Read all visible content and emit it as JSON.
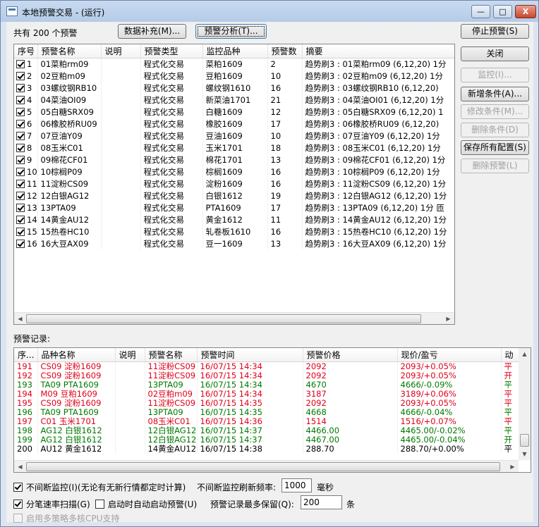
{
  "window": {
    "title": "本地预警交易 - (运行)",
    "min": "—",
    "max": "□",
    "close": "X"
  },
  "toolbar": {
    "count_label": "共有 200 个预警",
    "data_fill": "数据补充(M)...",
    "analysis": "预警分析(T)...",
    "stop": "停止预警(S)"
  },
  "side_buttons": {
    "close": "关闭",
    "monitor": "监控(I)...",
    "add_cond": "新增条件(A)...",
    "edit_cond": "修改条件(M)...",
    "del_cond": "删除条件(D)",
    "save_all": "保存所有配置(S)",
    "del_alert": "删除预警(L)"
  },
  "alerts": {
    "columns": [
      "序号",
      "预警名称",
      "说明",
      "预警类型",
      "监控品种",
      "预警数",
      "摘要"
    ],
    "rows": [
      {
        "no": "1",
        "name": "01菜粕rm09",
        "desc": "",
        "type": "程式化交易",
        "symbol": "菜粕1609",
        "count": "2",
        "summary": "趋势刷3 : 01菜粕rm09 (6,12,20) 1分",
        "checked": true
      },
      {
        "no": "2",
        "name": "02豆粕m09",
        "desc": "",
        "type": "程式化交易",
        "symbol": "豆粕1609",
        "count": "10",
        "summary": "趋势刷3 : 02豆粕m09 (6,12,20) 1分",
        "checked": true
      },
      {
        "no": "3",
        "name": "03螺纹钢RB10",
        "desc": "",
        "type": "程式化交易",
        "symbol": "螺纹钢1610",
        "count": "16",
        "summary": "趋势刷3 : 03螺纹钢RB10 (6,12,20)",
        "checked": true
      },
      {
        "no": "4",
        "name": "04菜油OI09",
        "desc": "",
        "type": "程式化交易",
        "symbol": "新菜油1701",
        "count": "21",
        "summary": "趋势刷3 : 04菜油OI01 (6,12,20) 1分",
        "checked": true
      },
      {
        "no": "5",
        "name": "05白糖SRX09",
        "desc": "",
        "type": "程式化交易",
        "symbol": "白糖1609",
        "count": "12",
        "summary": "趋势刷3 : 05白糖SRX09 (6,12,20) 1",
        "checked": true
      },
      {
        "no": "6",
        "name": "06橡胶桥RU09",
        "desc": "",
        "type": "程式化交易",
        "symbol": "橡胶1609",
        "count": "17",
        "summary": "趋势刷3 : 06橡胶桥RU09 (6,12,20)",
        "checked": true
      },
      {
        "no": "7",
        "name": "07豆油Y09",
        "desc": "",
        "type": "程式化交易",
        "symbol": "豆油1609",
        "count": "10",
        "summary": "趋势刷3 : 07豆油Y09 (6,12,20) 1分",
        "checked": true
      },
      {
        "no": "8",
        "name": "08玉米C01",
        "desc": "",
        "type": "程式化交易",
        "symbol": "玉米1701",
        "count": "18",
        "summary": "趋势刷3 : 08玉米C01 (6,12,20) 1分",
        "checked": true
      },
      {
        "no": "9",
        "name": "09棉花CF01",
        "desc": "",
        "type": "程式化交易",
        "symbol": "棉花1701",
        "count": "13",
        "summary": "趋势刷3 : 09棉花CF01 (6,12,20) 1分",
        "checked": true
      },
      {
        "no": "10",
        "name": "10棕榈P09",
        "desc": "",
        "type": "程式化交易",
        "symbol": "棕榈1609",
        "count": "16",
        "summary": "趋势刷3 : 10棕榈P09 (6,12,20) 1分",
        "checked": true
      },
      {
        "no": "11",
        "name": "11淀粉CS09",
        "desc": "",
        "type": "程式化交易",
        "symbol": "淀粉1609",
        "count": "16",
        "summary": "趋势刷3 : 11淀粉CS09 (6,12,20) 1分",
        "checked": true
      },
      {
        "no": "12",
        "name": "12白银AG12",
        "desc": "",
        "type": "程式化交易",
        "symbol": "白银1612",
        "count": "19",
        "summary": "趋势刷3 : 12白银AG12 (6,12,20) 1分",
        "checked": true
      },
      {
        "no": "13",
        "name": "13PTA09",
        "desc": "",
        "type": "程式化交易",
        "symbol": "PTA1609",
        "count": "17",
        "summary": "趋势刷3 : 13PTA09 (6,12,20) 1分 匝",
        "checked": true
      },
      {
        "no": "14",
        "name": "14黄金AU12",
        "desc": "",
        "type": "程式化交易",
        "symbol": "黄金1612",
        "count": "11",
        "summary": "趋势刷3 : 14黄金AU12 (6,12,20) 1分",
        "checked": true
      },
      {
        "no": "15",
        "name": "15热卷HC10",
        "desc": "",
        "type": "程式化交易",
        "symbol": "轧卷板1610",
        "count": "16",
        "summary": "趋势刷3 : 15热卷HC10 (6,12,20) 1分",
        "checked": true
      },
      {
        "no": "16",
        "name": "16大豆AX09",
        "desc": "",
        "type": "程式化交易",
        "symbol": "豆一1609",
        "count": "13",
        "summary": "趋势刷3 : 16大豆AX09 (6,12,20) 1分",
        "checked": true
      }
    ]
  },
  "records_label": "预警记录:",
  "records": {
    "columns": [
      "序...",
      "品种名称",
      "说明",
      "预警名称",
      "预警时间",
      "预警价格",
      "现价/盈亏",
      "动"
    ],
    "rows": [
      {
        "no": "191",
        "product": "CS09 淀粉1609",
        "desc": "",
        "alert": "11淀粉CS09",
        "time": "16/07/15 14:34",
        "price": "2092",
        "pnl": "2093/+0.05%",
        "act": "平",
        "color": "red"
      },
      {
        "no": "192",
        "product": "CS09 淀粉1609",
        "desc": "",
        "alert": "11淀粉CS09",
        "time": "16/07/15 14:34",
        "price": "2092",
        "pnl": "2093/+0.05%",
        "act": "开",
        "color": "red"
      },
      {
        "no": "193",
        "product": "TA09 PTA1609",
        "desc": "",
        "alert": "13PTA09",
        "time": "16/07/15 14:34",
        "price": "4670",
        "pnl": "4666/-0.09%",
        "act": "平",
        "color": "green"
      },
      {
        "no": "194",
        "product": "M09 豆粕1609",
        "desc": "",
        "alert": "02豆粕m09",
        "time": "16/07/15 14:34",
        "price": "3187",
        "pnl": "3189/+0.06%",
        "act": "平",
        "color": "red"
      },
      {
        "no": "195",
        "product": "CS09 淀粉1609",
        "desc": "",
        "alert": "11淀粉CS09",
        "time": "16/07/15 14:35",
        "price": "2092",
        "pnl": "2093/+0.05%",
        "act": "平",
        "color": "red"
      },
      {
        "no": "196",
        "product": "TA09 PTA1609",
        "desc": "",
        "alert": "13PTA09",
        "time": "16/07/15 14:35",
        "price": "4668",
        "pnl": "4666/-0.04%",
        "act": "平",
        "color": "green"
      },
      {
        "no": "197",
        "product": "C01 玉米1701",
        "desc": "",
        "alert": "08玉米C01",
        "time": "16/07/15 14:36",
        "price": "1514",
        "pnl": "1516/+0.07%",
        "act": "平",
        "color": "red"
      },
      {
        "no": "198",
        "product": "AG12 白银1612",
        "desc": "",
        "alert": "12白银AG12",
        "time": "16/07/15 14:37",
        "price": "4466.00",
        "pnl": "4465.00/-0.02%",
        "act": "平",
        "color": "green"
      },
      {
        "no": "199",
        "product": "AG12 白银1612",
        "desc": "",
        "alert": "12白银AG12",
        "time": "16/07/15 14:37",
        "price": "4467.00",
        "pnl": "4465.00/-0.04%",
        "act": "开",
        "color": "green"
      },
      {
        "no": "200",
        "product": "AU12 黄金1612",
        "desc": "",
        "alert": "14黄金AU12",
        "time": "16/07/15 14:38",
        "price": "288.70",
        "pnl": "288.70/+0.00%",
        "act": "平",
        "color": "black"
      }
    ]
  },
  "options": {
    "continuous_label": "不间断监控(I)(无论有无新行情都定时计算)",
    "freq_label": "不间断监控刷新频率:",
    "freq_value": "1000",
    "freq_unit": "毫秒",
    "tick_scan": "分笔速率扫描(G)",
    "auto_start": "启动时自动启动预警(U)",
    "keep_label": "预警记录最多保留(Q):",
    "keep_value": "200",
    "keep_unit": "条",
    "multicore": "启用多策略多核CPU支持"
  },
  "colors": {
    "red": "#e0001a",
    "green": "#007a00"
  }
}
